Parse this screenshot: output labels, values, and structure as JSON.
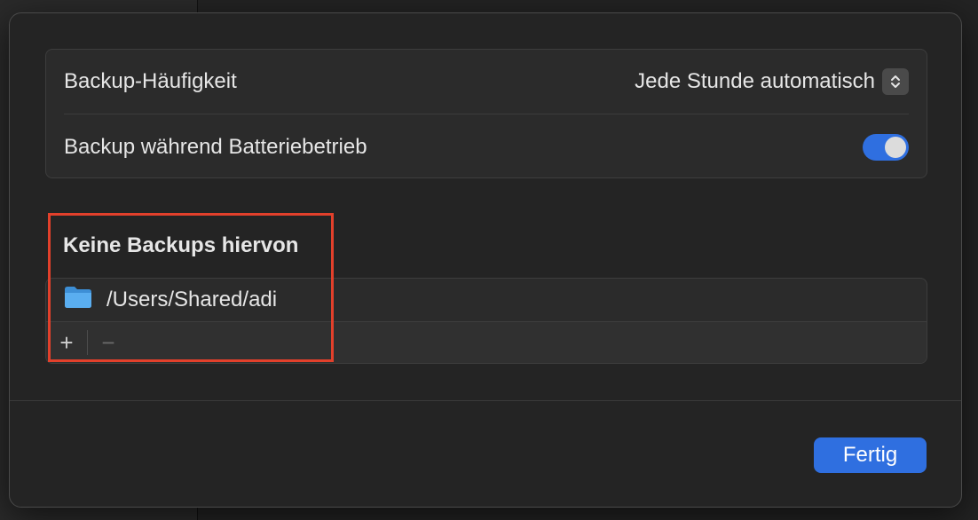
{
  "settings": {
    "backup_frequency": {
      "label": "Backup-Häufigkeit",
      "value": "Jede Stunde automatisch"
    },
    "battery_backup": {
      "label": "Backup während Batteriebetrieb",
      "enabled": true
    }
  },
  "exclusions": {
    "title": "Keine Backups hiervon",
    "items": [
      {
        "path": "/Users/Shared/adi",
        "icon": "folder-icon"
      }
    ],
    "add_label": "+",
    "remove_label": "−"
  },
  "footer": {
    "done_label": "Fertig"
  },
  "colors": {
    "accent": "#2f6fe0",
    "highlight": "#e2402b",
    "folder": "#5aaef0"
  }
}
